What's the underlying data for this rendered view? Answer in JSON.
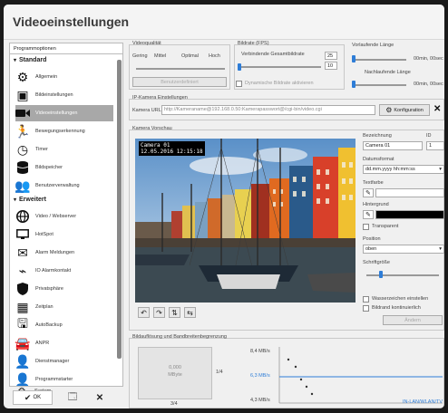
{
  "window": {
    "title": "Videoeinstellungen"
  },
  "sidebar": {
    "header": "Programmoptionen",
    "groups": [
      {
        "label": "Standard",
        "items": [
          {
            "label": "Allgemein",
            "icon": "gear-icon"
          },
          {
            "label": "Bildeinstellungen",
            "icon": "image-icon"
          },
          {
            "label": "Videoeinstellungen",
            "icon": "camera-icon"
          },
          {
            "label": "Bewegungserkennung",
            "icon": "running-man-icon"
          },
          {
            "label": "Timer",
            "icon": "clock-icon"
          },
          {
            "label": "Bildspeicher",
            "icon": "database-icon"
          },
          {
            "label": "Benutzerverwaltung",
            "icon": "users-icon"
          }
        ]
      },
      {
        "label": "Erweitert",
        "items": [
          {
            "label": "Video / Webserver",
            "icon": "globe-icon"
          },
          {
            "label": "HotSpot",
            "icon": "monitor-icon"
          },
          {
            "label": "Alarm Meldungen",
            "icon": "mail-icon"
          },
          {
            "label": "IO Alarmkontakt",
            "icon": "plug-icon"
          },
          {
            "label": "Privatsphäre",
            "icon": "shield-icon"
          },
          {
            "label": "Zeitplan",
            "icon": "calendar-icon"
          },
          {
            "label": "AutoBackup",
            "icon": "floppy-icon"
          },
          {
            "label": "ANPR",
            "icon": "car-icon"
          },
          {
            "label": "Dienstmanager",
            "icon": "user-gear-icon"
          },
          {
            "label": "Programmstarter",
            "icon": "user-play-icon"
          },
          {
            "label": "System",
            "icon": "system-icon"
          }
        ]
      }
    ],
    "footer": {
      "ok_label": "OK"
    }
  },
  "video_quality": {
    "title": "Videoqualität",
    "options": [
      "Gering",
      "Mittel",
      "Optimal",
      "Hoch"
    ],
    "button": "Benutzerdefiniert"
  },
  "bitrate": {
    "title": "Bildrate (FPS)",
    "label": "Verbindende Gesamtbildrate",
    "value": "25",
    "value2": "10",
    "checkbox_label": "Dynamische Bildrate aktivieren"
  },
  "vorlaeufer": {
    "title": "Vorlaufende Länge",
    "value": "00min, 00sec",
    "nachlauf_title": "Nachlaufende Länge",
    "nachlauf_value": "00min, 00sec"
  },
  "ipcam": {
    "title": "IP-Kamera Einstellungen",
    "url_label": "Kamera URL",
    "url_value": "http://Kameraname@192.168.0.50:Kamerapasswort@/cgi-bin/video.cgi",
    "config_label": "Konfiguration"
  },
  "preview": {
    "title": "Kamera Vorschau",
    "overlay_line1": "Camera 01",
    "overlay_line2": "12.05.2016 12:15:18",
    "toolbar": [
      "rotate-left-icon",
      "rotate-right-icon",
      "flip-icon",
      "mirror-icon"
    ]
  },
  "props": {
    "name_label": "Bezeichnung",
    "id_label": "ID",
    "name_value": "Camera 01",
    "id_value": "1",
    "date_label": "Datumsformat",
    "date_value": "dd.mm.yyyy hh:mm:ss",
    "fg_label": "Textfarbe",
    "bg_label": "Hintergrund",
    "fg_color": "#ffffff",
    "bg_color": "#000000",
    "transparent_label": "Transparent",
    "position_label": "Position",
    "position_value": "oben",
    "fontsize_label": "Schriftgröße",
    "wasserzeichen_label": "Wasserzeichen einstellen",
    "bildrand_label": "Bildrand kontinuierlich",
    "button_label": "Ändern"
  },
  "limits": {
    "title": "Bildauflösung und Bandbreitenbegrenzung",
    "res_box": "0,000\nMByte",
    "left_label": "1/4",
    "bottom_label": "3/4",
    "y_labels": [
      "8,4 MB/s",
      "6,3 MB/s",
      "4,3 MB/s"
    ],
    "link_text": "IN-LAN/WLAN/TV",
    "line_color": "#2e7dd7"
  }
}
